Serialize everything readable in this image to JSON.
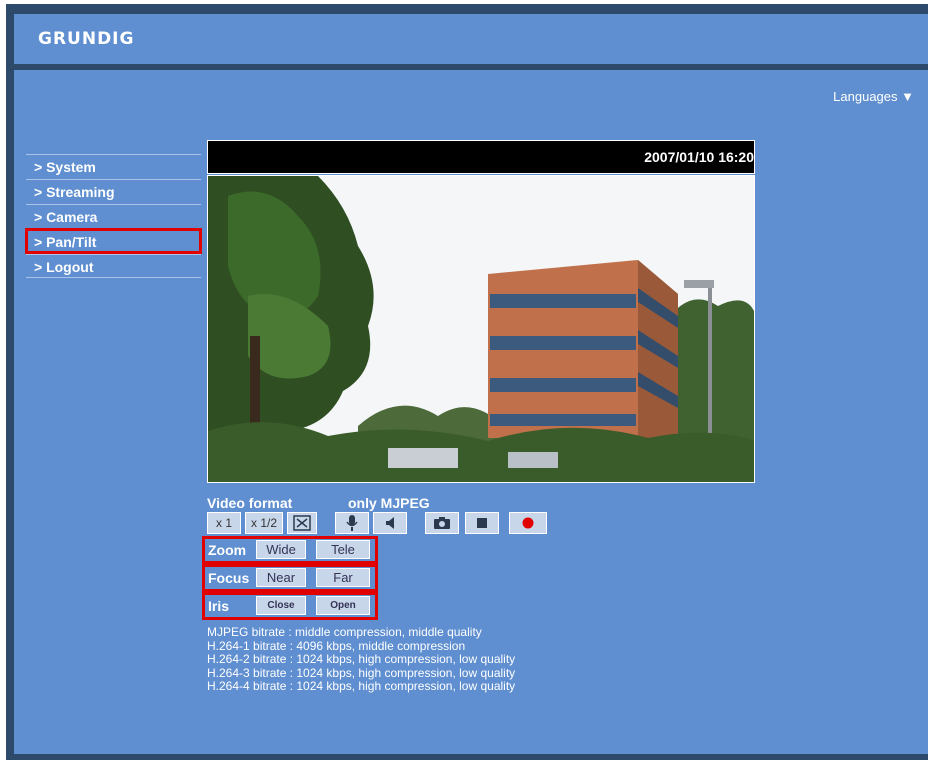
{
  "header": {
    "logo": "GRUNDIG"
  },
  "languages": {
    "label": "Languages ▼"
  },
  "nav": {
    "items": [
      {
        "label": "> System"
      },
      {
        "label": "> Streaming"
      },
      {
        "label": "> Camera"
      },
      {
        "label": "> Pan/Tilt"
      },
      {
        "label": "> Logout"
      }
    ]
  },
  "video": {
    "timestamp": "2007/01/10 16:20"
  },
  "video_format": {
    "label": "Video format",
    "value": "only MJPEG"
  },
  "toolbar": {
    "zoom_x1": "x 1",
    "zoom_half": "x 1/2",
    "icons": [
      "fullscreen-icon",
      "microphone-icon",
      "speaker-icon",
      "camera-icon",
      "stop-icon",
      "record-icon"
    ],
    "record_color": "#e00000"
  },
  "controls": {
    "zoom": {
      "label": "Zoom",
      "btn1": "Wide",
      "btn2": "Tele"
    },
    "focus": {
      "label": "Focus",
      "btn1": "Near",
      "btn2": "Far"
    },
    "iris": {
      "label": "Iris",
      "btn1": "Close",
      "btn2": "Open"
    }
  },
  "bitrates": [
    "MJPEG bitrate : middle compression, middle quality",
    "H.264-1 bitrate : 4096 kbps, middle compression",
    "H.264-2 bitrate : 1024 kbps, high compression, low quality",
    "H.264-3 bitrate : 1024 kbps, high compression, low quality",
    "H.264-4 bitrate : 1024 kbps, high compression, low quality"
  ],
  "colors": {
    "panel": "#5f8fd0",
    "frame": "#2e4a6b",
    "highlight": "#e00000",
    "button": "#c8d6ea"
  }
}
